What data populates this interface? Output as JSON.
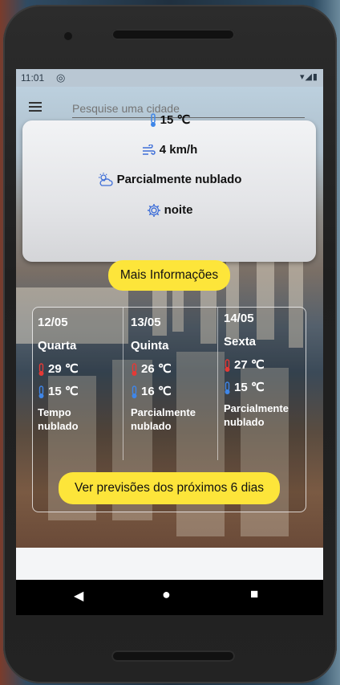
{
  "status": {
    "time": "11:01"
  },
  "app": {
    "search_placeholder": "Pesquise uma cidade",
    "temperature": "15 ℃",
    "wind": "4 km/h",
    "condition": "Parcialmente nublado",
    "period": "noite",
    "more_info_label": "Mais Informações",
    "forecast_button_label": "Ver previsões dos próximos 6 dias"
  },
  "forecast": [
    {
      "date": "12/05",
      "weekday": "Quarta",
      "max": "29 ℃",
      "min": "15 ℃",
      "condition_line1": "Tempo",
      "condition_line2": "nublado"
    },
    {
      "date": "13/05",
      "weekday": "Quinta",
      "max": "26 ℃",
      "min": "16 ℃",
      "condition_line1": "Parcialmente",
      "condition_line2": "nublado"
    },
    {
      "date": "14/05",
      "weekday": "Sexta",
      "max": "27 ℃",
      "min": "15 ℃",
      "condition_line1": "Parcialmente",
      "condition_line2": "nublado"
    }
  ],
  "colors": {
    "accent_yellow": "#fde53a",
    "thermometer_hot": "#e53935",
    "thermometer_cold": "#3f86e8",
    "icon_blue": "#3f6fd8"
  },
  "icons": [
    "menu-icon",
    "thermometer-icon",
    "wind-icon",
    "partly-cloudy-icon",
    "gear-icon",
    "back-icon",
    "home-icon",
    "recents-icon"
  ]
}
